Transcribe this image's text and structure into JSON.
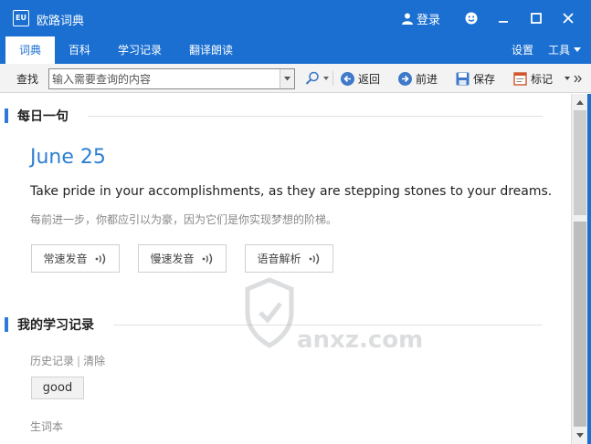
{
  "window": {
    "title": "欧路词典",
    "logo_text": "EU",
    "login_label": "登录"
  },
  "tabs": [
    {
      "label": "词典",
      "active": true
    },
    {
      "label": "百科"
    },
    {
      "label": "学习记录"
    },
    {
      "label": "翻译朗读"
    }
  ],
  "menu_right": {
    "settings": "设置",
    "tools": "工具"
  },
  "toolbar": {
    "find_label": "查找",
    "search_placeholder": "输入需要查询的内容",
    "back": "返回",
    "forward": "前进",
    "save": "保存",
    "bookmark": "标记"
  },
  "daily": {
    "section_title": "每日一句",
    "date": "June 25",
    "sentence_en": "Take pride in your accomplishments, as they are stepping stones to your dreams.",
    "sentence_zh": "每前进一步，你都应引以为豪，因为它们是你实现梦想的阶梯。",
    "buttons": [
      "常速发音",
      "慢速发音",
      "语音解析"
    ]
  },
  "records": {
    "section_title": "我的学习记录",
    "history_label": "历史记录",
    "clear_label": "清除",
    "history_items": [
      "good"
    ],
    "vocab_label": "生词本"
  },
  "watermark": {
    "text": "anxz.com"
  },
  "colors": {
    "accent": "#1a6fd1",
    "heading_blue": "#2f7fd0"
  }
}
